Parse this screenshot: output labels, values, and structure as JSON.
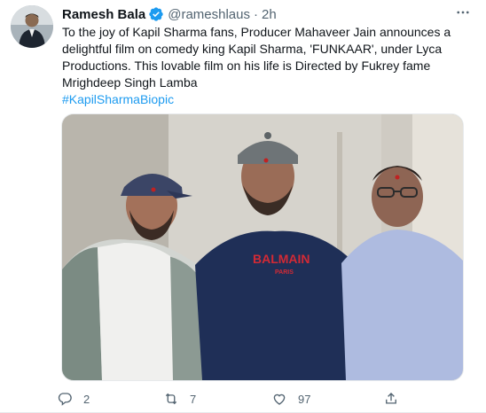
{
  "author": {
    "name": "Ramesh Bala",
    "handle": "@rameshlaus",
    "separator": "·",
    "time": "2h"
  },
  "tweet": {
    "text": "To the joy of Kapil Sharma fans, Producer Mahaveer Jain announces a delightful film on comedy king Kapil Sharma, 'FUNKAAR', under Lyca Productions. This lovable film on his life is Directed by Fukrey fame Mrighdeep Singh Lamba",
    "hashtag": "#KapilSharmaBiopic",
    "photo": {
      "shirt_text_line1": "BALMAIN",
      "shirt_text_line2": "PARIS"
    }
  },
  "actions": {
    "reply_count": "2",
    "retweet_count": "7",
    "like_count": "97"
  },
  "colors": {
    "accent": "#1d9bf0",
    "text": "#0f1419",
    "muted": "#536471"
  },
  "icons": [
    "more-icon",
    "verified-icon",
    "reply-icon",
    "retweet-icon",
    "like-icon",
    "share-icon"
  ]
}
